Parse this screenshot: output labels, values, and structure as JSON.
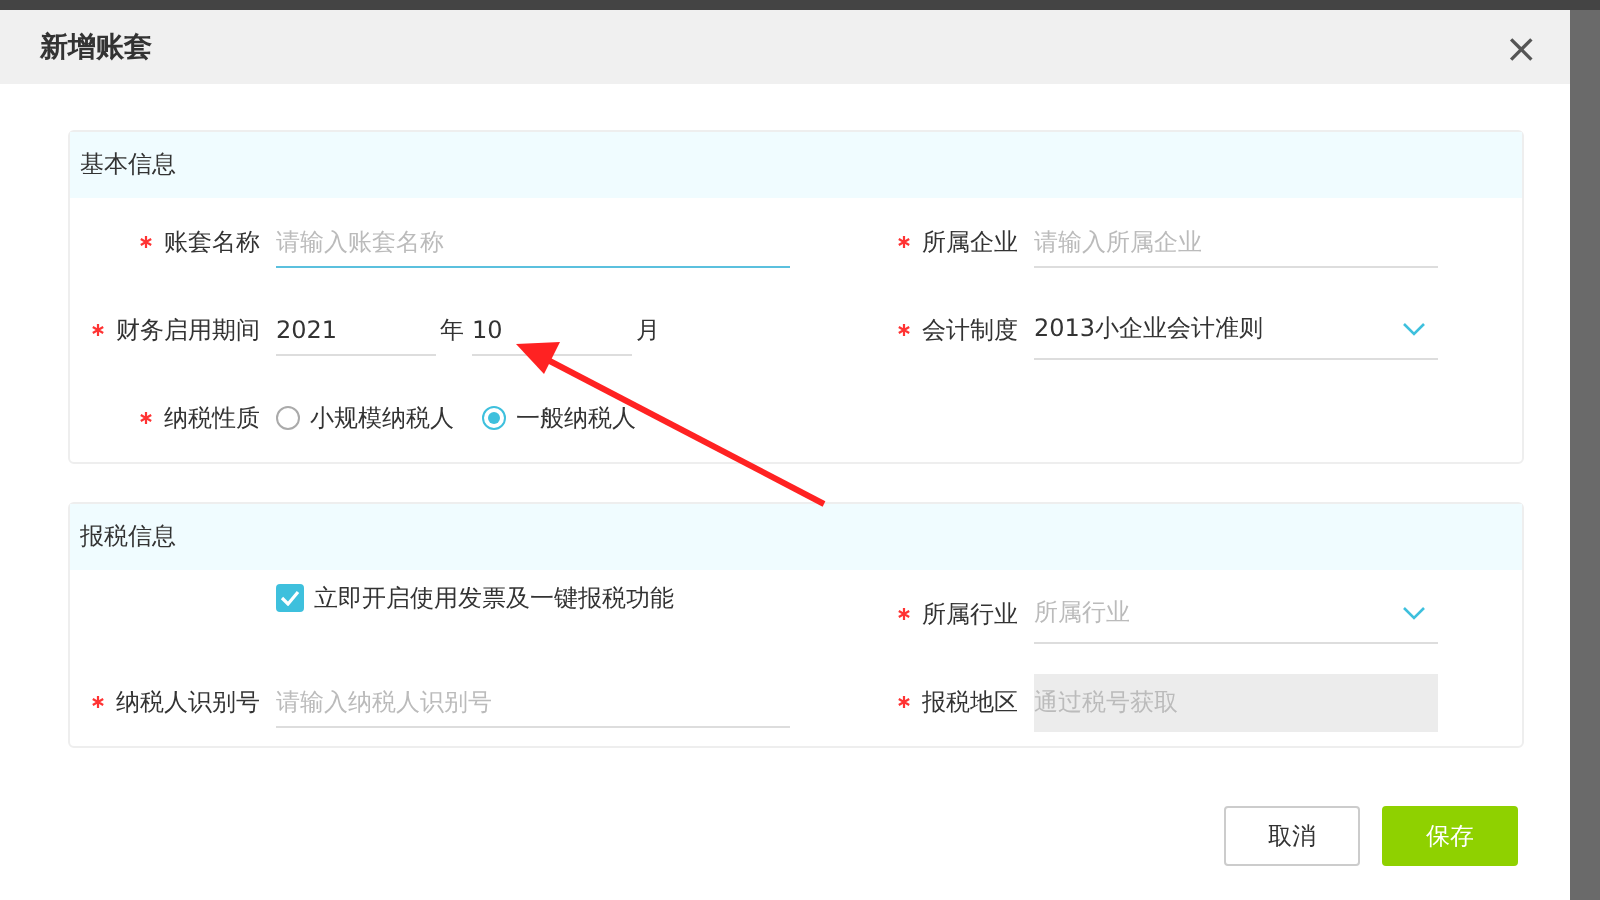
{
  "dialog": {
    "title": "新增账套",
    "close": "×"
  },
  "sections": [
    {
      "title": "基本信息",
      "rows": [
        [
          {
            "kind": "input",
            "label": "账套名称",
            "required": true,
            "placeholder": "请输入账套名称",
            "focused": true
          },
          {
            "kind": "input",
            "label": "所属企业",
            "required": true,
            "placeholder": "请输入所属企业",
            "focused": false
          }
        ],
        [
          {
            "kind": "period",
            "label": "财务启用期间",
            "required": true,
            "year": "2021",
            "year_unit": "年",
            "month": "10",
            "month_unit": "月"
          },
          {
            "kind": "select",
            "label": "会计制度",
            "required": true,
            "value": "2013小企业会计准则"
          }
        ],
        [
          {
            "kind": "radio",
            "label": "纳税性质",
            "required": true,
            "options": [
              {
                "label": "小规模纳税人",
                "selected": false
              },
              {
                "label": "一般纳税人",
                "selected": true
              }
            ]
          }
        ]
      ]
    },
    {
      "title": "报税信息",
      "rows": [
        [
          {
            "kind": "checkbox",
            "label": "立即开启使用发票及一键报税功能",
            "checked": true
          },
          {
            "kind": "select",
            "label": "所属行业",
            "required": true,
            "placeholder": "所属行业"
          }
        ],
        [
          {
            "kind": "input",
            "label": "纳税人识别号",
            "required": true,
            "placeholder": "请输入纳税人识别号",
            "focused": false
          },
          {
            "kind": "readonly",
            "label": "报税地区",
            "required": true,
            "placeholder": "通过税号获取"
          }
        ]
      ]
    }
  ],
  "buttons": [
    {
      "label": "取消",
      "kind": "secondary"
    },
    {
      "label": "保存",
      "kind": "primary"
    }
  ]
}
